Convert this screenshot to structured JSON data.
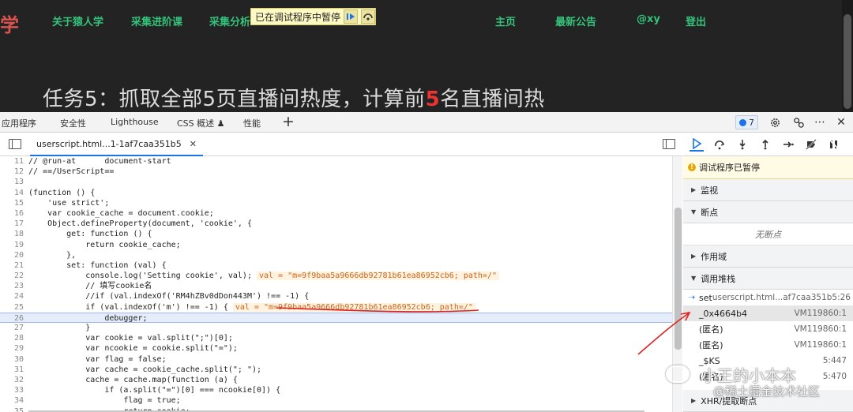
{
  "site": {
    "logo_char": "学",
    "nav": [
      "关于猿人学",
      "采集进阶课",
      "采集分析"
    ],
    "nav_right": [
      "主页",
      "最新公告",
      "@xy",
      "登出"
    ],
    "pause_banner": "已在调试程序中暂停",
    "heading_pre": "任务5：抓取全部5页直播间热度，计算前",
    "heading_hl": "5",
    "heading_post": "名直播间热"
  },
  "devtools": {
    "tabs": [
      "应用程序",
      "安全性",
      "Lighthouse",
      "CSS 概述 ♟",
      "性能"
    ],
    "issues_count": "7"
  },
  "source": {
    "file_tab": "userscript.html...1-1af7caa351b5",
    "lines": [
      {
        "n": "11",
        "code": "// @run-at      document-start"
      },
      {
        "n": "12",
        "code": "// ==/UserScript=="
      },
      {
        "n": "13",
        "code": ""
      },
      {
        "n": "14",
        "code": "(function () {"
      },
      {
        "n": "15",
        "code": "    'use strict';"
      },
      {
        "n": "16",
        "code": "    var cookie_cache = document.cookie;"
      },
      {
        "n": "17",
        "code": "    Object.defineProperty(document, 'cookie', {"
      },
      {
        "n": "18",
        "code": "        get: function () {"
      },
      {
        "n": "19",
        "code": "            return cookie_cache;"
      },
      {
        "n": "20",
        "code": "        },"
      },
      {
        "n": "21",
        "code": "        set: function (val) {"
      },
      {
        "n": "22",
        "code": "            console.log('Setting cookie', val);",
        "inline": "val = \"m=9f9baa5a9666db92781b61ea86952cb6; path=/\""
      },
      {
        "n": "23",
        "code": "            // 填写cookie名"
      },
      {
        "n": "24",
        "code": "            //if (val.indexOf('RM4hZBv0dDon443M') !== -1) {"
      },
      {
        "n": "25",
        "code": "            if (val.indexOf('m') !== -1) {",
        "inline": "val = \"m=9f9baa5a9666db92781b61ea86952cb6; path=/\""
      },
      {
        "n": "26",
        "code": "                debugger;",
        "highlight": true
      },
      {
        "n": "27",
        "code": "            }"
      },
      {
        "n": "28",
        "code": "            var cookie = val.split(\";\")[0];"
      },
      {
        "n": "29",
        "code": "            var ncookie = cookie.split(\"=\");"
      },
      {
        "n": "30",
        "code": "            var flag = false;"
      },
      {
        "n": "31",
        "code": "            var cache = cookie_cache.split(\"; \");"
      },
      {
        "n": "32",
        "code": "            cache = cache.map(function (a) {"
      },
      {
        "n": "33",
        "code": "                if (a.split(\"=\")[0] === ncookie[0]) {"
      },
      {
        "n": "34",
        "code": "                    flag = true;"
      },
      {
        "n": "35",
        "code": "                    return cookie;"
      }
    ]
  },
  "debugger": {
    "paused": "调试程序已暂停",
    "sections": {
      "watch": "监视",
      "breakpoints": "断点",
      "no_breakpoints": "无断点",
      "scope": "作用域",
      "callstack": "调用堆栈",
      "xhr": "XHR/提取断点"
    },
    "frames": [
      {
        "fn": "set",
        "loc": "userscript.html...af7caa351b5:26"
      },
      {
        "fn": "_0x4664b4",
        "loc": "VM119860:1"
      },
      {
        "fn": "(匿名)",
        "loc": "VM119860:1"
      },
      {
        "fn": "(匿名)",
        "loc": "VM119860:1"
      },
      {
        "fn": "_$KS",
        "loc": "5:447"
      },
      {
        "fn": "(匿名)",
        "loc": "5:470"
      }
    ]
  },
  "watermark": {
    "line1": "小王的小本本",
    "line2": "@稀土掘金技术社区"
  },
  "colors": {
    "annotation_red": "#e02020",
    "accent": "#1a73e8"
  }
}
